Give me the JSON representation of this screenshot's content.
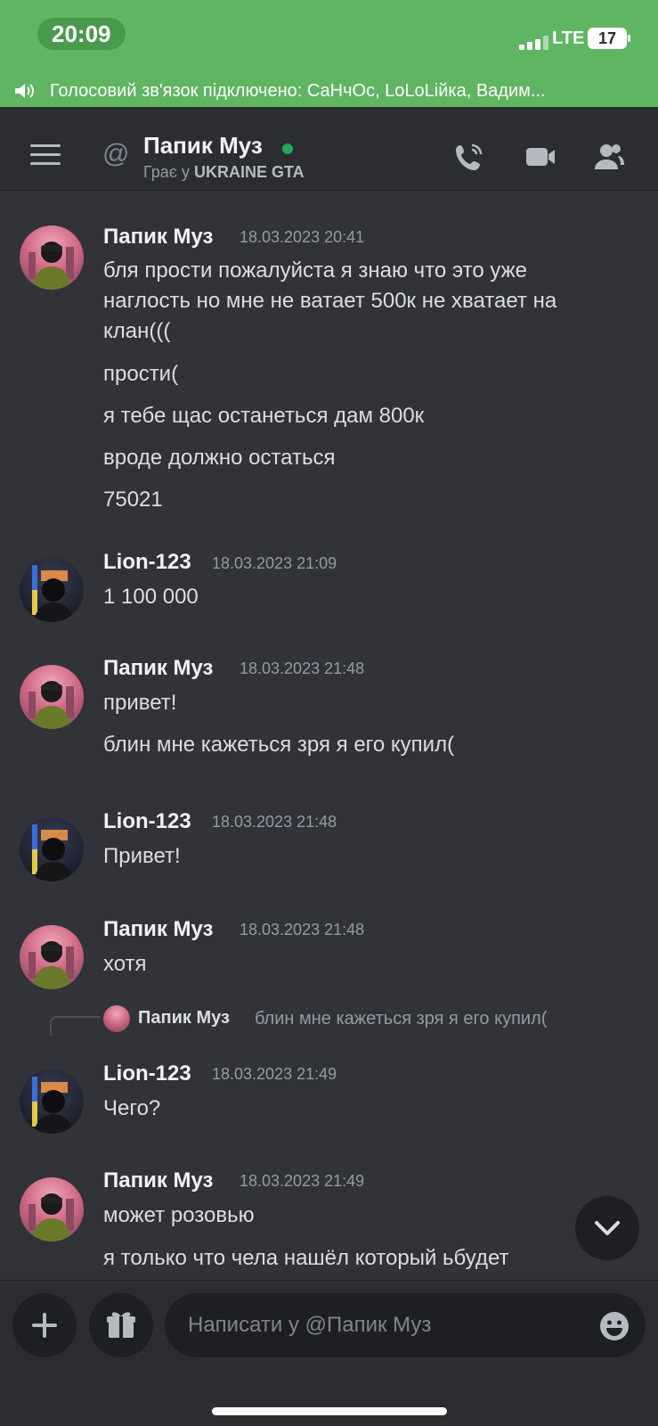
{
  "status_bar": {
    "time": "20:09",
    "network": "LTE",
    "battery": "17"
  },
  "voice_banner": {
    "text": "Голосовий зв'язок підключено: СаНчОс, LoLoLiйка, Вадим..."
  },
  "header": {
    "at_symbol": "@",
    "name": "Папик Муз",
    "status_prefix": "Грає у ",
    "status_game": "UKRAINE GTA"
  },
  "messages": [
    {
      "author": "Папик Муз",
      "timestamp": "18.03.2023 20:41",
      "lines": [
        "бля прости пожалуйста я знаю что это уже",
        "наглость но мне не ватает 500к не хватает на",
        "клан(((",
        "прости(",
        "я тебе щас останеться дам 800к",
        "вроде должно остаться",
        "75021"
      ]
    },
    {
      "author": "Lion-123",
      "timestamp": "18.03.2023 21:09",
      "lines": [
        "1 100 000"
      ]
    },
    {
      "author": "Папик Муз",
      "timestamp": "18.03.2023 21:48",
      "lines": [
        "привет!",
        "блин мне кажеться зря я его купил("
      ]
    },
    {
      "author": "Lion-123",
      "timestamp": "18.03.2023 21:48",
      "lines": [
        "Привет!"
      ]
    },
    {
      "author": "Папик Муз",
      "timestamp": "18.03.2023 21:48",
      "lines": [
        "хотя"
      ]
    },
    {
      "author": "Lion-123",
      "timestamp": "18.03.2023 21:49",
      "lines": [
        "Чего?"
      ],
      "reply_to": {
        "author": "Папик Муз",
        "text": "блин мне кажеться зря я его купил("
      }
    },
    {
      "author": "Папик Муз",
      "timestamp": "18.03.2023 21:49",
      "lines": [
        "может розовью",
        "я только что чела нашёл который ьбудет"
      ]
    }
  ],
  "composer": {
    "placeholder": "Написати у @Папик Муз"
  },
  "icons": {
    "menu": "hamburger-icon",
    "call": "phone-call-icon",
    "video": "video-camera-icon",
    "members": "members-icon",
    "add": "plus-icon",
    "gift": "gift-icon",
    "emoji": "emoji-icon",
    "jump": "chevron-down-icon",
    "voice": "speaker-icon"
  },
  "colors": {
    "status_green": "#5fb562",
    "online": "#23a55a",
    "background": "#313338",
    "header_bg": "#2b2d31"
  }
}
